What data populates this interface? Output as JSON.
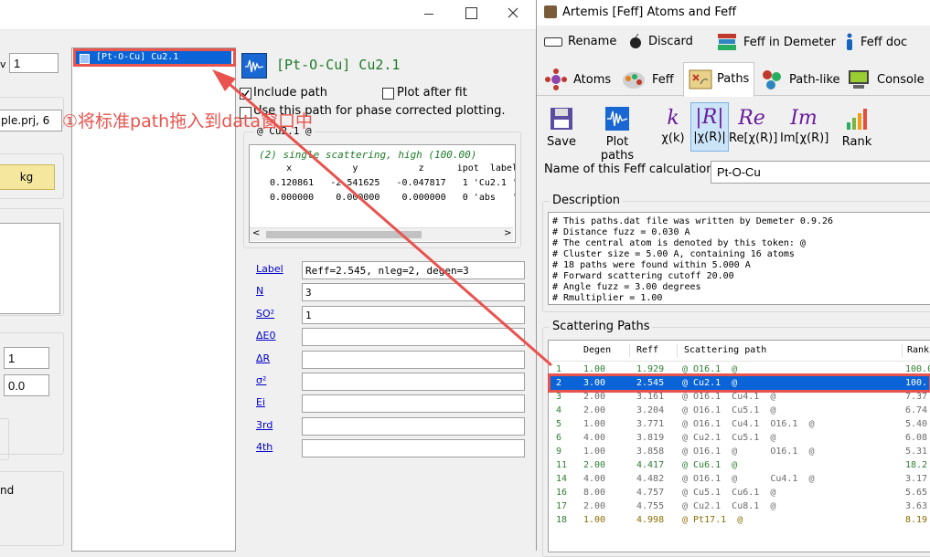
{
  "left": {
    "value1": "1",
    "project": "ple.prj, 6",
    "kg": "kg",
    "val_1": "1",
    "val_00": "0.0",
    "nd": "nd"
  },
  "middle": {
    "path_item": "[Pt-O-Cu] Cu2.1",
    "path_title": "[Pt-O-Cu] Cu2.1",
    "include_path": "Include path",
    "plot_after_fit": "Plot after fit",
    "use_phase": "Use this path for phase corrected plotting.",
    "legend": "@ Cu2.1  @",
    "feff_header": "(2) single scattering, high (100.00)",
    "coord_header": "     x           y           z      ipot  label",
    "coord_row1": "  0.120861   -2.541625   -0.047817   1 'Cu2.1 '",
    "coord_row2": "  0.000000    0.000000    0.000000   0 'abs   '",
    "params": [
      {
        "label": "Label",
        "value": "Reff=2.545, nleg=2, degen=3"
      },
      {
        "label": "N",
        "value": "3"
      },
      {
        "label": "SO²",
        "value": "1"
      },
      {
        "label": "ΔE0",
        "value": ""
      },
      {
        "label": "ΔR",
        "value": ""
      },
      {
        "label": "σ²",
        "value": ""
      },
      {
        "label": "Ei",
        "value": ""
      },
      {
        "label": "3rd",
        "value": ""
      },
      {
        "label": "4th",
        "value": ""
      }
    ]
  },
  "annotation": {
    "text": "①将标准path拖入到data窗口中",
    "color": "#e8534e"
  },
  "right": {
    "window_title": "Artemis [Feff] Atoms and Feff",
    "menu": {
      "rename": "Rename",
      "discard": "Discard",
      "feff_in_demeter": "Feff in Demeter",
      "feff_doc": "Feff doc"
    },
    "tabs": {
      "atoms": "Atoms",
      "feff": "Feff",
      "paths": "Paths",
      "path_like": "Path-like",
      "console": "Console"
    },
    "tools": {
      "save": "Save",
      "plot_paths": "Plot paths",
      "chik": "χ(k)",
      "chir": "|χ(R)|",
      "rechir": "Re[χ(R)]",
      "imchir": "Im[χ(R)]",
      "rank": "Rank",
      "k_glyph": "k",
      "r_glyph": "|R|",
      "re_glyph": "Re",
      "im_glyph": "Im"
    },
    "name_label": "Name of this Feff calculation:",
    "name_value": "Pt-O-Cu",
    "description_title": "Description",
    "description": [
      "# This paths.dat file was written by Demeter 0.9.26",
      "# Distance fuzz = 0.030 A",
      "# The central atom is denoted by this token: @",
      "# Cluster size = 5.00 A, containing 16 atoms",
      "# 18 paths were found within 5.000 A",
      "# Forward scattering cutoff 20.00",
      "# Angle fuzz = 3.00 degrees",
      "# Rmultiplier = 1.00"
    ],
    "scattering_title": "Scattering Paths",
    "columns": {
      "degen": "Degen",
      "reff": "Reff",
      "path": "Scattering path",
      "rank": "Rank"
    },
    "rows": [
      {
        "n": "1",
        "degen": "1.00",
        "reff": "1.929",
        "path": "@ O16.1  @",
        "rank": "100.0",
        "color": "#2e7d32"
      },
      {
        "n": "2",
        "degen": "3.00",
        "reff": "2.545",
        "path": "@ Cu2.1  @",
        "rank": "100.",
        "color": "#ffffff",
        "selected": true
      },
      {
        "n": "3",
        "degen": "2.00",
        "reff": "3.161",
        "path": "@ O16.1  Cu4.1  @",
        "rank": "7.37",
        "color": "#6b6b6b"
      },
      {
        "n": "4",
        "degen": "2.00",
        "reff": "3.204",
        "path": "@ O16.1  Cu5.1  @",
        "rank": "6.74",
        "color": "#6b6b6b"
      },
      {
        "n": "5",
        "degen": "1.00",
        "reff": "3.771",
        "path": "@ O16.1  Cu4.1  O16.1  @",
        "rank": "5.40",
        "color": "#6b6b6b"
      },
      {
        "n": "6",
        "degen": "4.00",
        "reff": "3.819",
        "path": "@ Cu2.1  Cu5.1  @",
        "rank": "6.08",
        "color": "#6b6b6b"
      },
      {
        "n": "9",
        "degen": "1.00",
        "reff": "3.858",
        "path": "@ O16.1  @      O16.1  @",
        "rank": "5.31",
        "color": "#6b6b6b"
      },
      {
        "n": "11",
        "degen": "2.00",
        "reff": "4.417",
        "path": "@ Cu6.1  @",
        "rank": "18.2",
        "color": "#2e7d32"
      },
      {
        "n": "14",
        "degen": "4.00",
        "reff": "4.482",
        "path": "@ O16.1  @      Cu4.1  @",
        "rank": "3.17",
        "color": "#6b6b6b"
      },
      {
        "n": "16",
        "degen": "8.00",
        "reff": "4.757",
        "path": "@ Cu5.1  Cu6.1  @",
        "rank": "5.65",
        "color": "#6b6b6b"
      },
      {
        "n": "17",
        "degen": "2.00",
        "reff": "4.755",
        "path": "@ Cu2.1  Cu8.1  @",
        "rank": "3.63",
        "color": "#6b6b6b"
      },
      {
        "n": "18",
        "degen": "1.00",
        "reff": "4.998",
        "path": "@ Pt17.1  @",
        "rank": "8.19",
        "color": "#8a6d00"
      }
    ]
  }
}
